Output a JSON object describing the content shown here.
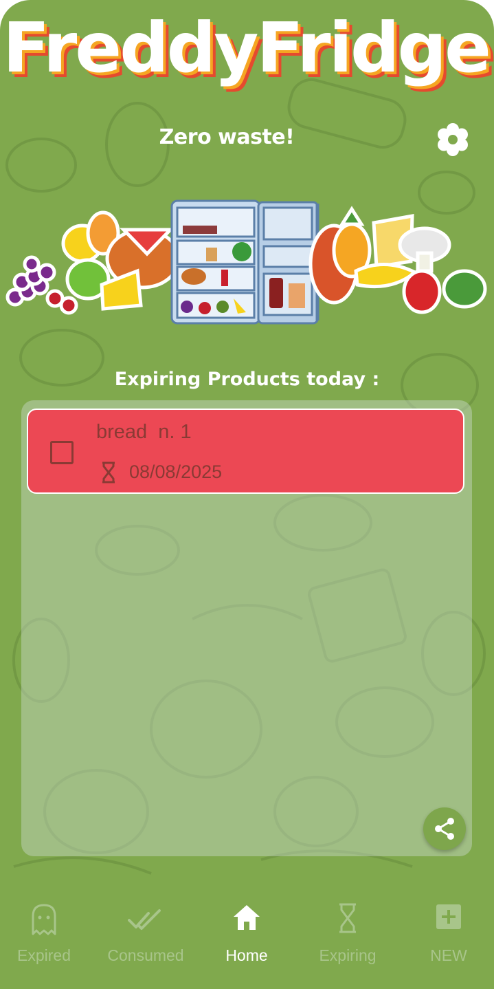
{
  "app": {
    "logo_text": "FreddyFridge",
    "tagline": "Zero waste!"
  },
  "section_title": "Expiring Products today :",
  "products": [
    {
      "name": "bread  n. 1",
      "expiry_date": "08/08/2025",
      "checked": false
    }
  ],
  "colors": {
    "background": "#80a94d",
    "card_expiring": "#ec4854",
    "card_text": "#8a3a34",
    "nav_inactive": "#a8c58a",
    "nav_active": "#ffffff"
  },
  "nav": {
    "items": [
      {
        "label": "Expired",
        "icon": "ghost-icon",
        "active": false
      },
      {
        "label": "Consumed",
        "icon": "double-check-icon",
        "active": false
      },
      {
        "label": "Home",
        "icon": "home-icon",
        "active": true
      },
      {
        "label": "Expiring",
        "icon": "hourglass-icon",
        "active": false
      },
      {
        "label": "NEW",
        "icon": "add-box-icon",
        "active": false
      }
    ]
  },
  "icons": {
    "settings": "gear-flower-icon",
    "share": "share-icon"
  }
}
